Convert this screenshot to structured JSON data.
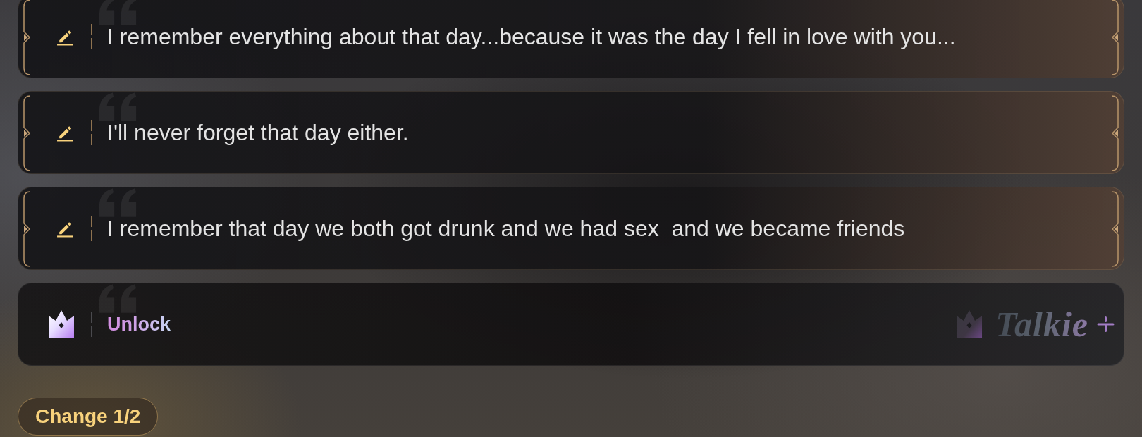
{
  "replies": [
    {
      "kind": "editable",
      "text": "I remember everything about that day...because it was the day I fell in love with you..."
    },
    {
      "kind": "editable",
      "text": "I'll never forget that day either."
    },
    {
      "kind": "editable",
      "text": "I remember that day we both got drunk and we had sex  and we became friends"
    },
    {
      "kind": "locked",
      "text": "Unlock",
      "brand": "Talkie"
    }
  ],
  "change_button": {
    "label": "Change 1/2"
  }
}
